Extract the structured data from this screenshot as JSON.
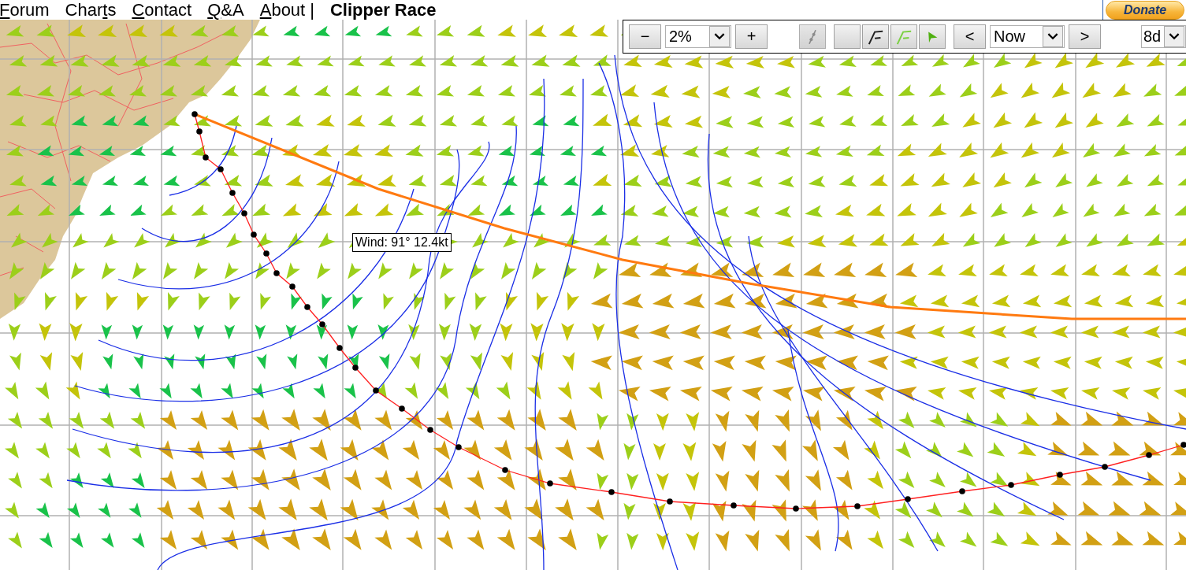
{
  "nav": {
    "links": [
      {
        "key": "F",
        "suffix": "orum"
      },
      {
        "prefix": "Char",
        "key": "t",
        "suffix": "s"
      },
      {
        "key": "C",
        "suffix": "ontact"
      },
      {
        "key": "Q",
        "suffix": "&A"
      },
      {
        "key": "A",
        "suffix": "bout"
      }
    ],
    "separator": "|",
    "title": "Clipper Race"
  },
  "donate": "Donate",
  "toolbar": {
    "zoom": {
      "out": "−",
      "value": "2%",
      "in": "+"
    },
    "tools": [
      {
        "kind": "route",
        "disabled": true
      },
      {
        "kind": "blank",
        "disabled": false
      },
      {
        "kind": "line-black",
        "disabled": false
      },
      {
        "kind": "line-green",
        "disabled": false
      },
      {
        "kind": "arrow",
        "disabled": false
      }
    ],
    "time": {
      "prev": "<",
      "value": "Now",
      "next": ">"
    },
    "range": {
      "value": "8d"
    }
  },
  "map": {
    "tooltip": "Wind: 91° 12.4kt"
  }
}
